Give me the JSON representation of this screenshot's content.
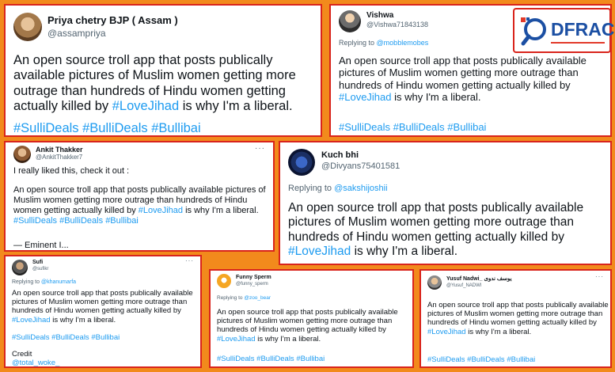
{
  "cards": {
    "priya": {
      "name": "Priya chetry BJP ( Assam )",
      "handle": "@assampriya",
      "text": "An open source troll app that posts publically available pictures of Muslim women getting more outrage than hundreds of Hindu women getting actually killed by",
      "lovejihad": "#LoveJihad",
      "tail": " is why I'm a liberal.",
      "tags": "#SulliDeals #BulliDeals #Bullibai"
    },
    "vishwa": {
      "name": "Vishwa",
      "handle": "@Vishwa71843138",
      "replying_label": "Replying to",
      "replying_to": "@mobblemobes",
      "text": "An open source troll app that posts publically available pictures of Muslim women getting more outrage than hundreds of Hindu women getting actually killed by",
      "lovejihad": "#LoveJihad",
      "tail": " is why I'm a liberal.",
      "tags": "#SulliDeals #BulliDeals #Bullibai"
    },
    "ankit": {
      "name": "Ankit Thakker",
      "handle": "@AnkitThakker7",
      "intro": "I really liked this, check it out :",
      "text": "An open source troll app that posts publically available pictures of Muslim women getting more outrage than hundreds of Hindu women getting actually killed by",
      "lovejihad": "#LoveJihad",
      "tail": " is why I'm a liberal. ",
      "tags_inline": "#SulliDeals #BulliDeals",
      "tags_last": "#Bullibai",
      "sign": "— Eminent I..."
    },
    "kuch": {
      "name": "Kuch bhi",
      "handle": "@Divyans75401581",
      "replying_label": "Replying to",
      "replying_to": "@sakshijoshii",
      "text": "An open source troll app that posts publically available pictures of Muslim women getting more outrage than hundreds of Hindu women getting actually killed by",
      "lovejihad": "#LoveJihad",
      "tail": " is why I'm a liberal."
    },
    "sufi": {
      "name": "Sufi",
      "handle": "@sufikr",
      "replying_label": "Replying to",
      "replying_to": "@khanumarfa",
      "text": "An open source troll app that posts publically available pictures of Muslim women getting more outrage than hundreds of Hindu women getting actually killed by",
      "lovejihad": "#LoveJihad",
      "tail": " is why I'm a liberal.",
      "tags": "#SulliDeals #BulliDeals #Bullibai",
      "credit": "Credit",
      "credit_handle": "@total_woke_"
    },
    "funny": {
      "name": "Funny Sperm",
      "handle": "@funny_sperm",
      "replying_label": "Replying to",
      "replying_to": "@zoo_bear",
      "text": "An open source troll app that posts publically available pictures of Muslim women getting more outrage than hundreds of Hindu women getting actually killed by",
      "lovejihad": "#LoveJihad",
      "tail": " is why I'm a liberal.",
      "tags": "#SulliDeals #BulliDeals #Bullibai"
    },
    "yusuf": {
      "name": "Yusuf Nadwi_ یوسف ندوی",
      "handle": "@Yusuf_NADWI",
      "text": "An open source troll app that posts publically available pictures of Muslim women getting more outrage than hundreds of Hindu women getting actually killed by",
      "lovejihad": "#LoveJihad",
      "tail": " is why I'm a liberal.",
      "tags": "#SulliDeals #BulliDeals #Bullibai"
    }
  },
  "logo": {
    "text": "DFRAC",
    "icon": "magnifier-logo-icon"
  },
  "more_icon": "···",
  "colors": {
    "background": "#f28a1c",
    "border": "#d9241c",
    "link": "#1d9bf0",
    "logo_blue": "#1b4fa3"
  }
}
